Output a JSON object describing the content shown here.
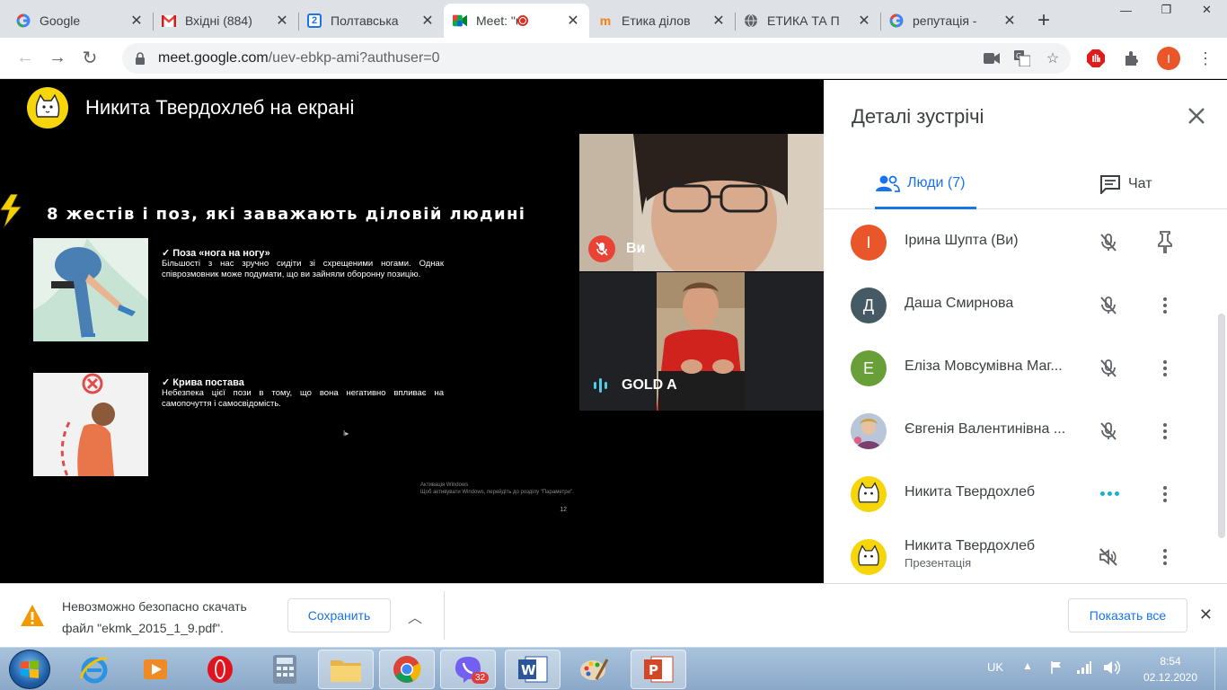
{
  "browser": {
    "tabs": [
      {
        "title": "Google",
        "favicon": "google-icon"
      },
      {
        "title": "Вхідні (884)",
        "favicon": "gmail-icon"
      },
      {
        "title": "Полтавська",
        "favicon": "calendar-icon"
      },
      {
        "title": "Meet: \"u",
        "favicon": "meet-icon",
        "recording": true
      },
      {
        "title": "Етика ділов",
        "favicon": "moodle-icon"
      },
      {
        "title": "ЕТИКА ТА П",
        "favicon": "globe-icon"
      },
      {
        "title": "репутація -",
        "favicon": "google-icon"
      }
    ],
    "url_host": "meet.google.com",
    "url_path": "/uev-ebkp-ami?authuser=0",
    "profile_initial": "I"
  },
  "meet": {
    "presenter_banner": "Никита Твердохлеб на екрані",
    "slide": {
      "title": "8 жестів і поз, які заважають діловій людині",
      "items": [
        {
          "heading": "✓  Поза «нога на ногу»",
          "body": "Більшості з нас зручно сидіти зі схрещеними ногами. Однак співрозмовник може подумати, що ви зайняли оборонну позицію."
        },
        {
          "heading": "✓  Крива постава",
          "body": "Небезпека цієї пози в тому, що вона негативно впливає на самопочуття і самосвідомість."
        }
      ],
      "footer_line1": "Активація Windows",
      "footer_line2": "Щоб активувати Windows, перейдіть до розділу \"Параметри\".",
      "cursor": "I▸",
      "page_number": "12"
    },
    "tiles": [
      {
        "label": "Ви",
        "muted": true
      },
      {
        "label": "GOLD A",
        "speaking": true
      }
    ]
  },
  "panel": {
    "title": "Деталі зустрічі",
    "tab_people": "Люди (7)",
    "tab_chat": "Чат",
    "participants": [
      {
        "name": "Ірина Шупта (Ви)",
        "initial": "І",
        "color": "#e8562a",
        "state": "muted",
        "action": "pin"
      },
      {
        "name": "Даша Смирнова",
        "initial": "Д",
        "color": "#455a64",
        "state": "muted",
        "action": "more"
      },
      {
        "name": "Еліза Мовсумівна Маг...",
        "initial": "Е",
        "color": "#689f38",
        "state": "muted",
        "action": "more"
      },
      {
        "name": "Євгенія Валентинівна ...",
        "initial": "",
        "color": "photo",
        "state": "muted",
        "action": "more"
      },
      {
        "name": "Никита Твердохлеб",
        "initial": "",
        "color": "cat",
        "state": "speaking",
        "action": "more"
      },
      {
        "name": "Никита Твердохлеб",
        "subtitle": "Презентація",
        "initial": "",
        "color": "cat",
        "state": "volume-off",
        "action": "more"
      }
    ]
  },
  "download": {
    "line1": "Невозможно безопасно скачать",
    "line2": "файл \"ekmk_2015_1_9.pdf\".",
    "save_label": "Сохранить",
    "show_all_label": "Показать все"
  },
  "taskbar": {
    "language": "UK",
    "time": "8:54",
    "date": "02.12.2020",
    "viber_badge": "32",
    "apps": [
      "ie-icon",
      "media-player-icon",
      "opera-icon",
      "calculator-icon",
      "explorer-icon",
      "chrome-icon",
      "viber-icon",
      "word-icon",
      "paint-icon",
      "powerpoint-icon"
    ]
  }
}
